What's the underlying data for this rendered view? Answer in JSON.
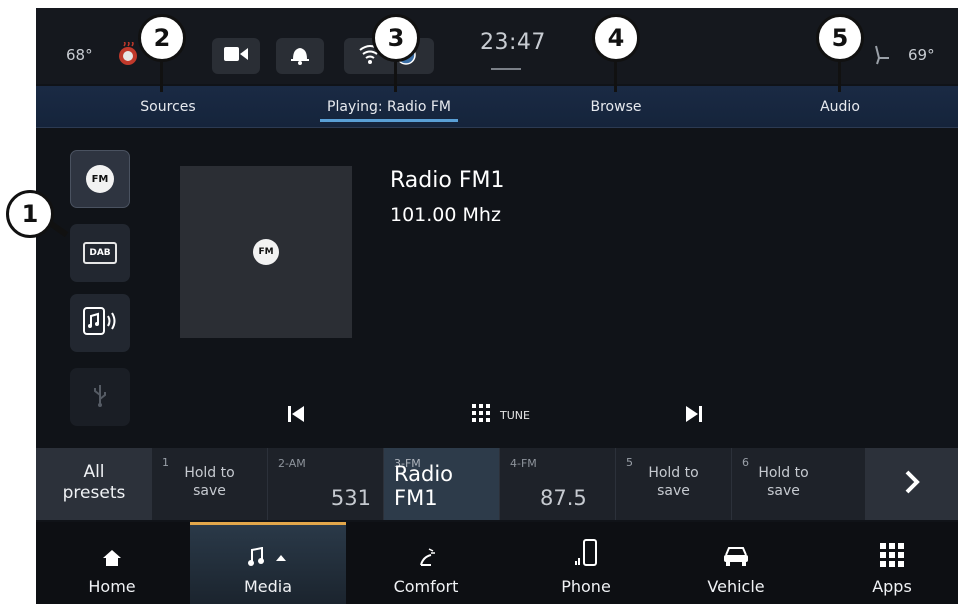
{
  "status_bar": {
    "temp_left": "68°",
    "temp_right": "69°",
    "clock": "23:47",
    "icons": [
      "heated-seat-icon",
      "camera-icon",
      "notification-bell-icon",
      "wifi-icon",
      "nav-globe-icon",
      "seat-icon"
    ]
  },
  "tabs": {
    "sources": "Sources",
    "playing": "Playing: Radio FM",
    "browse": "Browse",
    "audio": "Audio"
  },
  "sources": {
    "fm_label": "FM",
    "dab_label": "DAB"
  },
  "now_playing": {
    "art_label": "FM",
    "station": "Radio FM1",
    "frequency": "101.00 Mhz"
  },
  "controls": {
    "tune_label": "TUNE"
  },
  "presets": {
    "all_label_line1": "All",
    "all_label_line2": "presets",
    "items": [
      {
        "num": "1",
        "hold1": "Hold to",
        "hold2": "save"
      },
      {
        "band": "2-AM",
        "value": "531"
      },
      {
        "band": "3-FM",
        "value": "Radio FM1"
      },
      {
        "band": "4-FM",
        "value": "87.5"
      },
      {
        "num": "5",
        "hold1": "Hold to",
        "hold2": "save"
      },
      {
        "num": "6",
        "hold1": "Hold to",
        "hold2": "save"
      }
    ]
  },
  "nav": {
    "home": "Home",
    "media": "Media",
    "comfort": "Comfort",
    "phone": "Phone",
    "vehicle": "Vehicle",
    "apps": "Apps"
  },
  "callouts": [
    "1",
    "2",
    "3",
    "4",
    "5"
  ],
  "colors": {
    "accent_tab": "#5aa0d6",
    "media_accent": "#e2a64a",
    "background": "#101318"
  }
}
